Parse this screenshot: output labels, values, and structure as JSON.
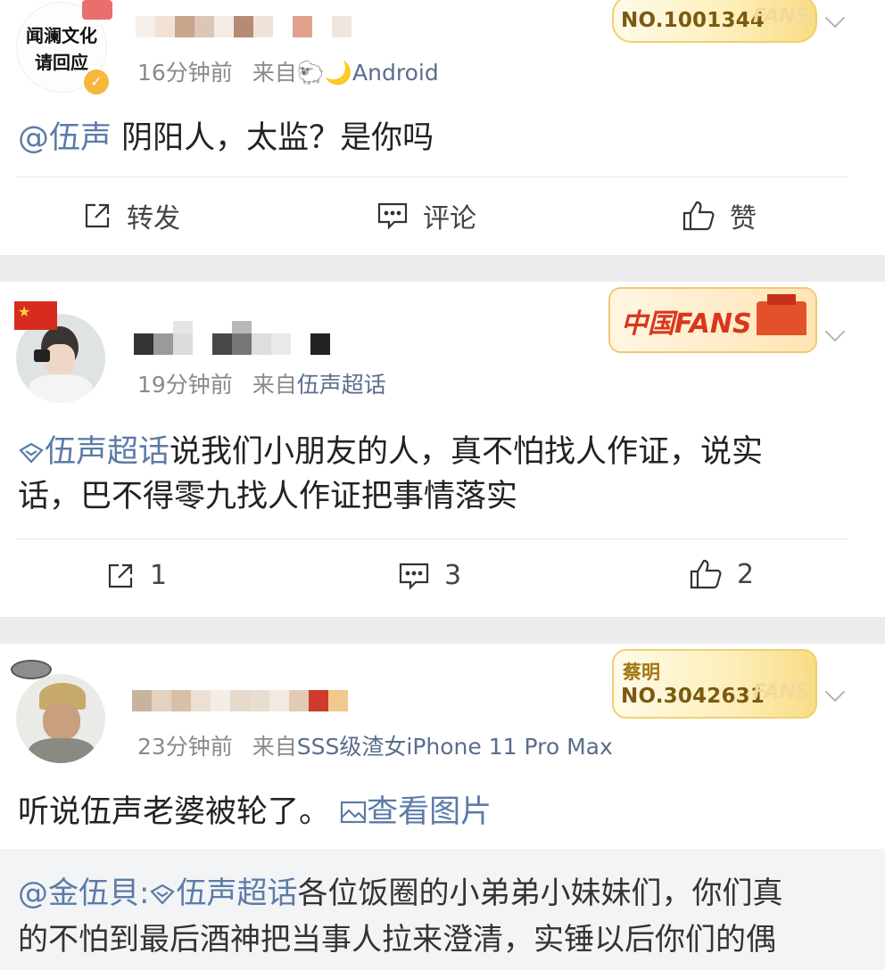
{
  "post1": {
    "avatar_text": "闻澜文化请回应",
    "time": "16分钟前",
    "source_prefix": "来自",
    "source": "🐑🌙Android",
    "badge_no": "NO.1001344",
    "badge_fans": "FANS",
    "mention": "@伍声",
    "content": " 阴阳人，太监？是你吗",
    "actions": {
      "repost": "转发",
      "comment": "评论",
      "like": "赞"
    }
  },
  "post2": {
    "time": "19分钟前",
    "source_prefix": "来自",
    "source": "伍声超话",
    "badge_text": "中国FANS",
    "topic": "伍声超话",
    "content_line1": "说我们小朋友的人，真不怕找人作证，说实",
    "content_line2": "话，巴不得零九找人作证把事情落实",
    "actions": {
      "repost": "1",
      "comment": "3",
      "like": "2"
    }
  },
  "post3": {
    "time": "23分钟前",
    "source_prefix": "来自",
    "source": "SSS级渣女iPhone 11 Pro Max",
    "badge_name": "蔡明",
    "badge_no": "NO.3042631",
    "badge_fans": "FANS",
    "content": "听说伍声老婆被轮了。",
    "view_image": "查看图片",
    "retweet": {
      "author": "@金伍貝:",
      "topic": "伍声超话",
      "line1": "各位饭圈的小弟弟小妹妹们，你们真",
      "line2": "的不怕到最后酒神把当事人拉来澄清，实锤以后你们的偶"
    }
  },
  "colors": {
    "link": "#5b7ba8",
    "separator": "#ececec",
    "badge_gold": "#f8dc86",
    "text": "#222222",
    "meta": "#8a8a8a"
  }
}
